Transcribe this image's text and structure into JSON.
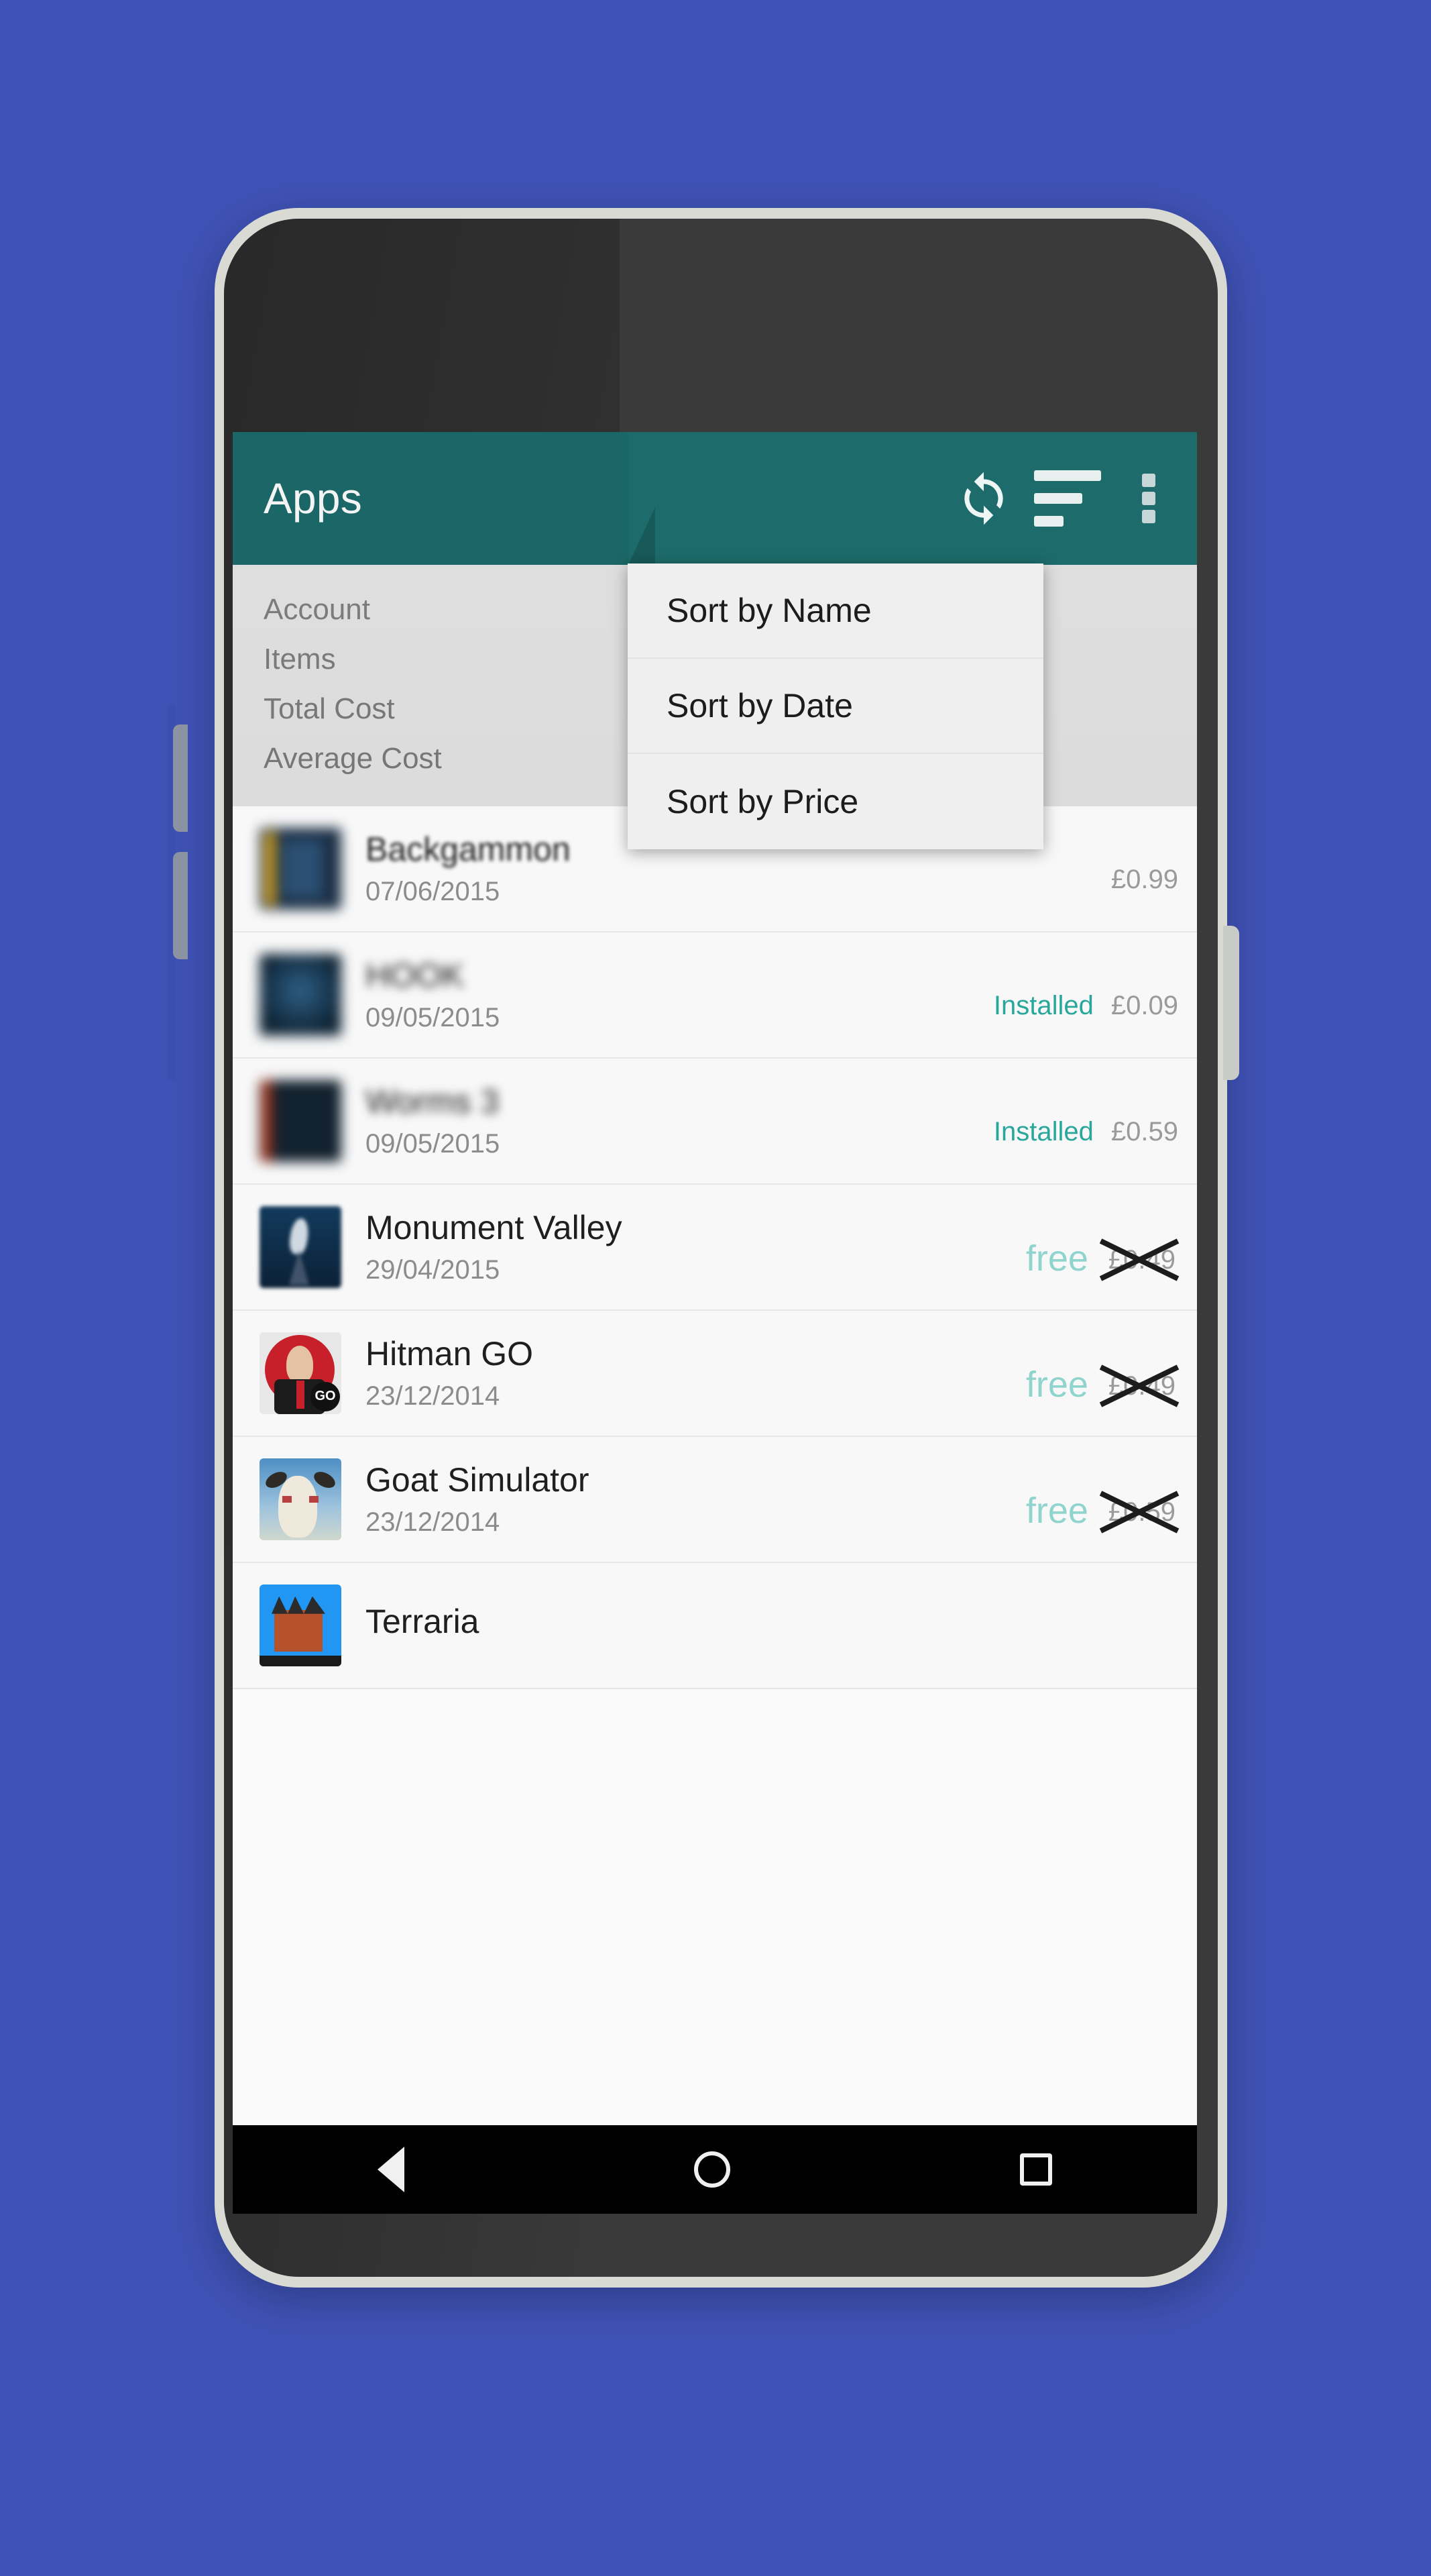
{
  "background_color": "#3f52b5",
  "accent_color": "#1d6b6b",
  "installed_color": "#2aa79b",
  "free_color": "#8fd4cd",
  "app_bar": {
    "title": "Apps",
    "refresh_icon": "refresh-icon",
    "sort_icon": "sort-icon",
    "overflow_icon": "overflow-menu-icon"
  },
  "summary": {
    "rows": [
      {
        "label": "Account"
      },
      {
        "label": "Items"
      },
      {
        "label": "Total Cost"
      },
      {
        "label": "Average Cost"
      }
    ]
  },
  "sort_menu": {
    "items": [
      {
        "label": "Sort by Name"
      },
      {
        "label": "Sort by Date"
      },
      {
        "label": "Sort by Price"
      }
    ]
  },
  "app_list": {
    "rows": [
      {
        "name": "Backgammon",
        "date": "07/06/2015",
        "installed": "",
        "price": "£0.99",
        "free": "",
        "crossed": false,
        "icon": "backgammon-app-icon"
      },
      {
        "name": "HOOK",
        "date": "09/05/2015",
        "installed": "Installed",
        "price": "£0.09",
        "free": "",
        "crossed": false,
        "icon": "hook-app-icon"
      },
      {
        "name": "Worms 3",
        "date": "09/05/2015",
        "installed": "Installed",
        "price": "£0.59",
        "free": "",
        "crossed": false,
        "icon": "worms3-app-icon"
      },
      {
        "name": "Monument Valley",
        "date": "29/04/2015",
        "installed": "",
        "price": "£0.49",
        "free": "free",
        "crossed": true,
        "icon": "monument-valley-app-icon"
      },
      {
        "name": "Hitman GO",
        "date": "23/12/2014",
        "installed": "",
        "price": "£0.49",
        "free": "free",
        "crossed": true,
        "icon": "hitman-go-app-icon",
        "badge": "GO"
      },
      {
        "name": "Goat Simulator",
        "date": "23/12/2014",
        "installed": "",
        "price": "£0.59",
        "free": "free",
        "crossed": true,
        "icon": "goat-simulator-app-icon"
      },
      {
        "name": "Terraria",
        "date": "",
        "installed": "",
        "price": "",
        "free": "",
        "crossed": false,
        "icon": "terraria-app-icon"
      }
    ]
  },
  "nav_bar": {
    "back": "back-icon",
    "home": "home-icon",
    "recents": "recents-icon"
  }
}
